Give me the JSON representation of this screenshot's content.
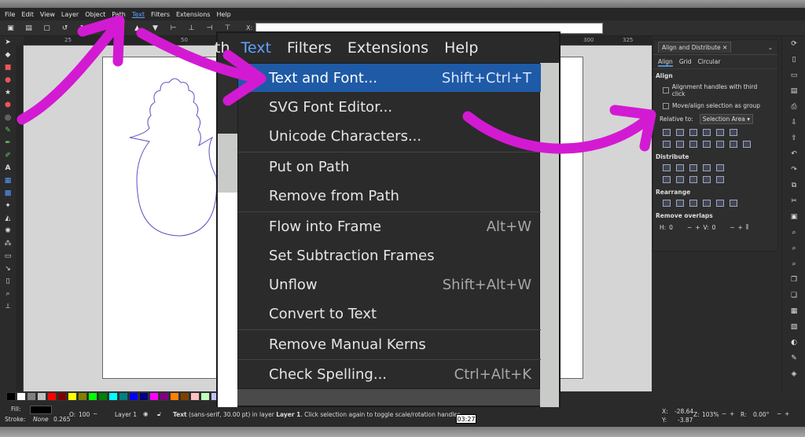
{
  "menubar": {
    "items": [
      "File",
      "Edit",
      "View",
      "Layer",
      "Object",
      "Path",
      "Text",
      "Filters",
      "Extensions",
      "Help"
    ],
    "active": "Text"
  },
  "ctrlbar": {
    "x_label": "X:"
  },
  "rulers": {
    "t1": "25",
    "t2": "50",
    "t3": "300",
    "t4": "325"
  },
  "zoom_menubar": {
    "partial": "th",
    "text": "Text",
    "filters": "Filters",
    "extensions": "Extensions",
    "help": "Help"
  },
  "dropdown": {
    "items": [
      {
        "label": "Text and Font...",
        "shortcut": "Shift+Ctrl+T"
      },
      {
        "label": "SVG Font Editor...",
        "shortcut": ""
      },
      {
        "label": "Unicode Characters...",
        "shortcut": ""
      },
      {
        "label": "Put on Path",
        "shortcut": ""
      },
      {
        "label": "Remove from Path",
        "shortcut": ""
      },
      {
        "label": "Flow into Frame",
        "shortcut": "Alt+W"
      },
      {
        "label": "Set Subtraction Frames",
        "shortcut": ""
      },
      {
        "label": "Unflow",
        "shortcut": "Shift+Alt+W"
      },
      {
        "label": "Convert to Text",
        "shortcut": ""
      },
      {
        "label": "Remove Manual Kerns",
        "shortcut": ""
      },
      {
        "label": "Check Spelling...",
        "shortcut": "Ctrl+Alt+K"
      }
    ]
  },
  "panel": {
    "title": "Align and Distribute",
    "tabs": [
      "Align",
      "Grid",
      "Circular"
    ],
    "align_heading": "Align",
    "opt1": "Alignment handles with third click",
    "opt2": "Move/align selection as group",
    "relative_label": "Relative to:",
    "relative_value": "Selection Area",
    "distribute_heading": "Distribute",
    "rearrange_heading": "Rearrange",
    "overlaps_heading": "Remove overlaps",
    "h_label": "H:",
    "h_value": "0",
    "v_label": "V:",
    "v_value": "0"
  },
  "status": {
    "fill_label": "Fill:",
    "stroke_label": "Stroke:",
    "stroke_value": "None",
    "stroke_width": "0.265",
    "opacity_label": "O:",
    "opacity_value": "100",
    "layer": "Layer 1",
    "msg_bold": "Text",
    "msg_rest": "(sans-serif, 30.00 pt) in layer",
    "msg_layer": "Layer 1",
    "msg_end": ". Click selection again to toggle scale/rotation handles.",
    "x_label": "X:",
    "x_value": "-28.64",
    "y_label": "Y:",
    "y_value": "-3.87",
    "z_label": "Z:",
    "zoom": "103%",
    "r_label": "R:",
    "rotation": "0.00°",
    "timestamp": "03:27"
  },
  "palette": [
    "#000000",
    "#ffffff",
    "#808080",
    "#c0c0c0",
    "#ff0000",
    "#800000",
    "#ffff00",
    "#808000",
    "#00ff00",
    "#008000",
    "#00ffff",
    "#008080",
    "#0000ff",
    "#000080",
    "#ff00ff",
    "#800080",
    "#ff8000",
    "#804000",
    "#ffc0c0",
    "#c0ffc0",
    "#c0c0ff",
    "#404040",
    "#606060",
    "#a0a0a0",
    "#e0e0e0",
    "#f0f0f0",
    "#d0d0d0",
    "#b0b0b0",
    "#909090",
    "#707070",
    "#505050",
    "#303030"
  ],
  "colors": {
    "arrow": "#d31ad3",
    "highlight": "#1f5aa6"
  }
}
